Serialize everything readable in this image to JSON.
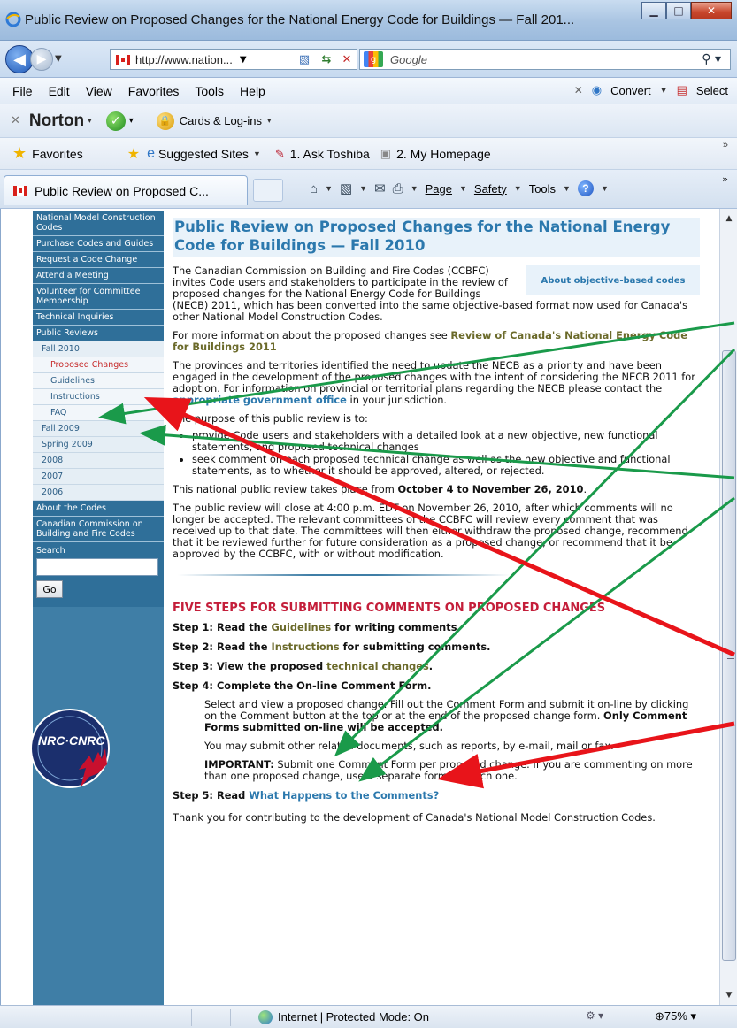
{
  "window": {
    "title": "Public Review on Proposed Changes for the National Energy Code for Buildings — Fall 201..."
  },
  "address_bar": {
    "url": "http://www.nation...",
    "search_placeholder": "Google"
  },
  "menu": {
    "items": [
      "File",
      "Edit",
      "View",
      "Favorites",
      "Tools",
      "Help"
    ],
    "convert_label": "Convert",
    "select_label": "Select"
  },
  "norton": {
    "logo": "Norton",
    "cards_label": "Cards & Log-ins"
  },
  "favorites_bar": {
    "favorites_label": "Favorites",
    "suggested_label": "Suggested Sites",
    "ask_label": "1. Ask Toshiba",
    "home_label": "2. My Homepage"
  },
  "tab": {
    "label": "Public Review on Proposed C..."
  },
  "command_bar": {
    "page_label": "Page",
    "safety_label": "Safety",
    "tools_label": "Tools"
  },
  "sidebar": {
    "items": [
      {
        "label": "National Model Construction Codes",
        "level": 0
      },
      {
        "label": "Purchase Codes and Guides",
        "level": 0
      },
      {
        "label": "Request a Code Change",
        "level": 0
      },
      {
        "label": "Attend a Meeting",
        "level": 0
      },
      {
        "label": "Volunteer for Committee Membership",
        "level": 0
      },
      {
        "label": "Technical Inquiries",
        "level": 0
      },
      {
        "label": "Public Reviews",
        "level": 0
      },
      {
        "label": "Fall 2010",
        "level": 1
      },
      {
        "label": "Proposed Changes",
        "level": 2
      },
      {
        "label": "Guidelines",
        "level": 2
      },
      {
        "label": "Instructions",
        "level": 2
      },
      {
        "label": "FAQ",
        "level": 2
      },
      {
        "label": "Fall 2009",
        "level": 1
      },
      {
        "label": "Spring 2009",
        "level": 1
      },
      {
        "label": "2008",
        "level": 1
      },
      {
        "label": "2007",
        "level": 1
      },
      {
        "label": "2006",
        "level": 1
      },
      {
        "label": "About the Codes",
        "level": 0
      },
      {
        "label": "Canadian Commission on Building and Fire Codes",
        "level": 0
      }
    ],
    "search_label": "Search",
    "go_label": "Go",
    "logo_text": "NRC·CNRC"
  },
  "main": {
    "title": "Public Review on Proposed Changes for the National Energy Code for Buildings — Fall 2010",
    "about_box": "About objective-based codes",
    "intro": "The Canadian Commission on Building and Fire Codes (CCBFC) invites Code users and stakeholders to participate in the review of proposed changes for the National Energy Code for Buildings (NECB) 2011, which has been converted into the same objective-based format now used for Canada's other National Model Construction Codes.",
    "more_info_pre": "For more information about the proposed changes see ",
    "more_info_link": "Review of Canada's National Energy Code for Buildings 2011",
    "provinces_pre": "The provinces and territories identified the need to update the NECB as a priority and have been engaged in the development of the proposed changes with the intent of considering the NECB 2011 for adoption. For information on provincial or territorial plans regarding the NECB please contact the ",
    "provinces_link": "appropriate government office",
    "provinces_post": " in your jurisdiction.",
    "purpose": "The purpose of this public review is to:",
    "bullets": [
      "provide Code users and stakeholders with a detailed look at a new objective, new functional statements, and proposed technical changes",
      "seek comment on each proposed technical change as well as the new objective and functional statements, as to whether it should be approved, altered, or rejected."
    ],
    "dates_pre": "This national public review takes place from ",
    "dates_bold": "October 4 to November 26, 2010",
    "dates_post": ".",
    "close": "The public review will close at 4:00 p.m. EDT on November 26, 2010, after which comments will no longer be accepted. The relevant committees of the CCBFC will review every comment that was received up to that date. The committees will then either withdraw the proposed change, recommend that it be reviewed further for future consideration as a proposed change, or recommend that it be approved by the CCBFC, with or without modification.",
    "five_steps": "FIVE STEPS FOR SUBMITTING COMMENTS ON PROPOSED CHANGES",
    "step1_pre": "Step 1: Read the ",
    "step1_link": "Guidelines",
    "step1_post": " for writing comments.",
    "step2_pre": "Step 2: Read the ",
    "step2_link": "Instructions",
    "step2_post": " for submitting comments.",
    "step3_pre": "Step 3: View the proposed ",
    "step3_link": "technical changes",
    "step3_post": ".",
    "step4": "Step 4: Complete the On-line Comment Form.",
    "step4_p1": "Select and view a proposed change. Fill out the Comment Form and submit it on-line by clicking on the Comment button at the top or at the end of the proposed change form. ",
    "step4_p1_bold": "Only Comment Forms submitted on-line will be accepted.",
    "step4_p2": "You may submit other related documents, such as reports, by e-mail, mail or fax.",
    "step4_p3_bold": "IMPORTANT:",
    "step4_p3": " Submit one Comment Form per proposed change. If you are commenting on more than one proposed change, use a separate form for each one.",
    "step5_pre": "Step 5: Read ",
    "step5_link": "What Happens to the Comments?",
    "thanks": "Thank you for contributing to the development of Canada's National Model Construction Codes."
  },
  "status_bar": {
    "zone": "Internet | Protected Mode: On",
    "zoom": "75%"
  },
  "colors": {
    "sidebar_bg": "#2f6f99",
    "title_blue": "#2b78ad",
    "heading_red": "#c41e3a",
    "arrow_green": "#1a9a4a",
    "arrow_red": "#e8141a"
  }
}
